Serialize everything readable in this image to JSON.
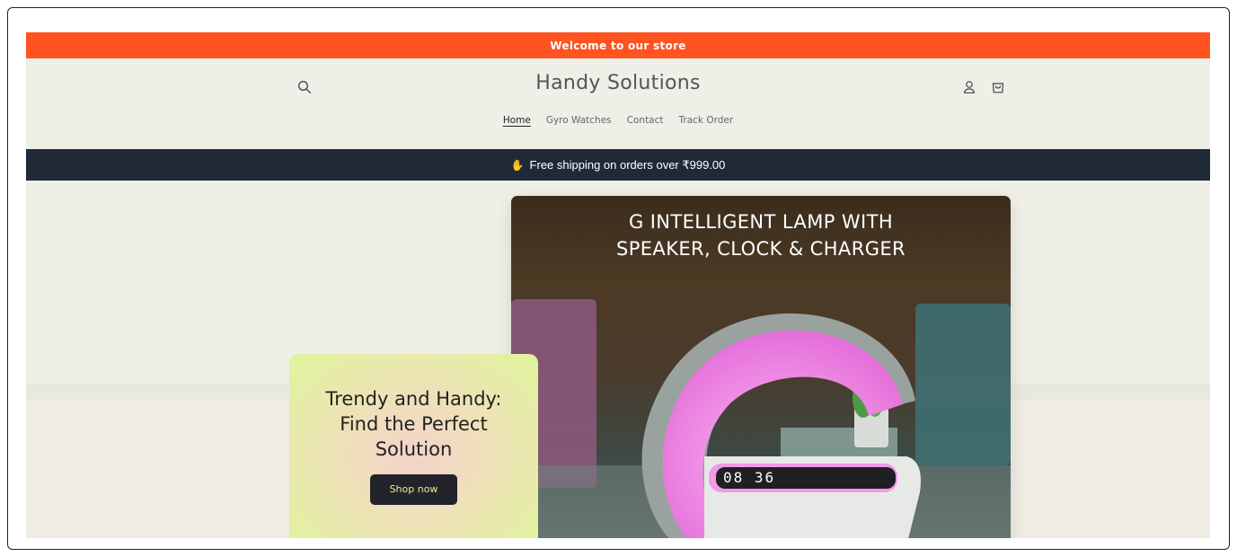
{
  "announcement": {
    "text": "Welcome to our store"
  },
  "header": {
    "logo": "Handy Solutions",
    "nav": [
      {
        "label": "Home",
        "active": true
      },
      {
        "label": "Gyro Watches",
        "active": false
      },
      {
        "label": "Contact",
        "active": false
      },
      {
        "label": "Track Order",
        "active": false
      }
    ],
    "icons": {
      "search": "search-icon",
      "account": "account-icon",
      "cart": "cart-icon"
    }
  },
  "shipping": {
    "icon": "waving-hand-icon",
    "text": "Free shipping on orders over ₹999.00"
  },
  "hero": {
    "image_title_line1": "G INTELLIGENT LAMP WITH",
    "image_title_line2": "SPEAKER, CLOCK & CHARGER",
    "clock_display": "08 36",
    "heading": "Trendy and Handy: Find the Perfect Solution",
    "button_label": "Shop now"
  },
  "colors": {
    "announcement_bg": "#ff5320",
    "page_bg": "#efeee7",
    "shipping_bg": "#1f2a36",
    "button_bg": "#23232b",
    "button_text": "#e6f08f",
    "lamp_glow": "#f08ae8"
  }
}
